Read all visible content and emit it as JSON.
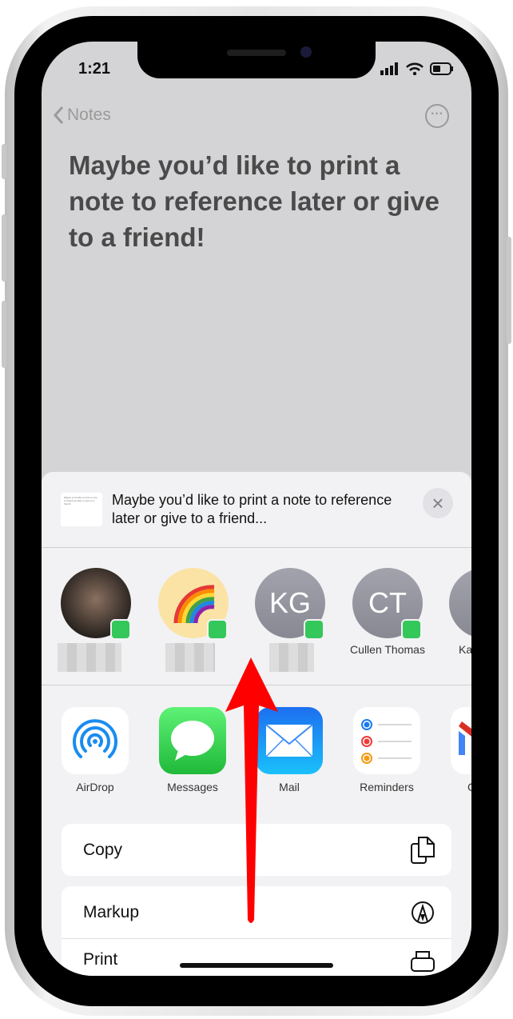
{
  "status_bar": {
    "time": "1:21"
  },
  "nav": {
    "back_label": "Notes",
    "more_icon": "ellipsis-circle-icon"
  },
  "note": {
    "title": "Maybe you’d like to print a note to reference later or give to a friend!"
  },
  "share_sheet": {
    "preview_title": "Maybe you’d like to print a note to reference later or give to a friend...",
    "thumbnail_text": "Maybe you’d like to print a note to reference later or give to a friend!",
    "contacts": [
      {
        "initials": "",
        "name": "",
        "avatar": "photo"
      },
      {
        "initials": "",
        "name": "",
        "avatar": "rainbow"
      },
      {
        "initials": "KG",
        "name": ""
      },
      {
        "initials": "CT",
        "name": "Cullen Thomas"
      },
      {
        "initials": "K",
        "name": "Ka"
      }
    ],
    "apps": [
      {
        "label": "AirDrop",
        "icon": "airdrop-icon"
      },
      {
        "label": "Messages",
        "icon": "messages-icon"
      },
      {
        "label": "Mail",
        "icon": "mail-icon"
      },
      {
        "label": "Reminders",
        "icon": "reminders-icon"
      },
      {
        "label": "G",
        "icon": "gmail-icon"
      }
    ],
    "actions": [
      {
        "label": "Copy",
        "icon": "copy-icon"
      },
      {
        "label": "Markup",
        "icon": "markup-icon"
      },
      {
        "label": "Print",
        "icon": "print-icon"
      }
    ]
  },
  "colors": {
    "arrow": "#ff0000",
    "badge": "#34c759",
    "airdrop": "#1a8cf0"
  }
}
